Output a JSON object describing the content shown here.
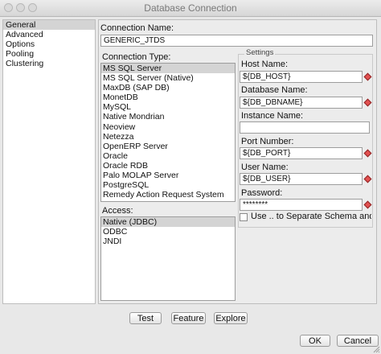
{
  "window": {
    "title": "Database Connection"
  },
  "sidebar": {
    "items": [
      {
        "label": "General",
        "selected": true
      },
      {
        "label": "Advanced",
        "selected": false
      },
      {
        "label": "Options",
        "selected": false
      },
      {
        "label": "Pooling",
        "selected": false
      },
      {
        "label": "Clustering",
        "selected": false
      }
    ]
  },
  "connection_name": {
    "label": "Connection Name:",
    "value": "GENERIC_JTDS"
  },
  "connection_type": {
    "label": "Connection Type:",
    "items": [
      "MS SQL Server",
      "MS SQL Server (Native)",
      "MaxDB (SAP DB)",
      "MonetDB",
      "MySQL",
      "Native Mondrian",
      "Neoview",
      "Netezza",
      "OpenERP Server",
      "Oracle",
      "Oracle RDB",
      "Palo MOLAP Server",
      "PostgreSQL",
      "Remedy Action Request System"
    ],
    "selected": "MS SQL Server"
  },
  "access": {
    "label": "Access:",
    "items": [
      "Native (JDBC)",
      "ODBC",
      "JNDI"
    ],
    "selected": "Native (JDBC)"
  },
  "settings": {
    "legend": "Settings",
    "host_label": "Host Name:",
    "host_value": "${DB_HOST}",
    "dbname_label": "Database Name:",
    "dbname_value": "${DB_DBNAME}",
    "instance_label": "Instance Name:",
    "instance_value": "",
    "port_label": "Port Number:",
    "port_value": "${DB_PORT}",
    "user_label": "User Name:",
    "user_value": "${DB_USER}",
    "password_label": "Password:",
    "password_value": "********",
    "separate_schema_label": "Use .. to Separate Schema and Tabl",
    "separate_schema_checked": false
  },
  "buttons": {
    "test": "Test",
    "feature": "Feature",
    "explore": "Explore",
    "ok": "OK",
    "cancel": "Cancel"
  },
  "colors": {
    "selection": "#d4d4d4",
    "variable_marker": "#e35151"
  }
}
